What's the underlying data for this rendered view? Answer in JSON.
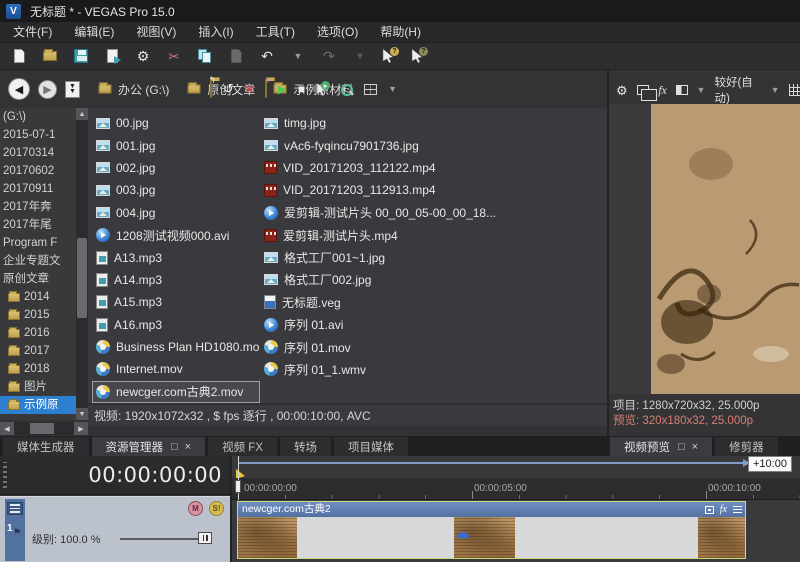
{
  "window": {
    "title": "无标题 * - VEGAS Pro 15.0",
    "app_icon_letter": "V"
  },
  "menu": {
    "items": [
      {
        "label": "文件(F)"
      },
      {
        "label": "编辑(E)"
      },
      {
        "label": "视图(V)"
      },
      {
        "label": "插入(I)"
      },
      {
        "label": "工具(T)"
      },
      {
        "label": "选项(O)"
      },
      {
        "label": "帮助(H)"
      }
    ]
  },
  "toolbar": {
    "icons": [
      "new-project",
      "open-project",
      "save-project",
      "publish",
      "project-properties",
      "cut",
      "copy",
      "paste",
      "undo",
      "undo-dropdown",
      "redo",
      "redo-dropdown",
      "interactive-tutorials",
      "whats-this-help"
    ]
  },
  "explorer": {
    "toolbar_icons": [
      "back",
      "forward",
      "history-dropdown",
      "up-one-level",
      "refresh",
      "delete",
      "new-folder",
      "start-preview",
      "stop-preview",
      "auto-preview",
      "media-search",
      "views",
      "views-dropdown"
    ],
    "address": [
      {
        "label": "办公 (G:\\)",
        "type": "drive"
      },
      {
        "label": "原创文章",
        "type": "folder"
      },
      {
        "label": "示例原材料",
        "type": "folder"
      }
    ],
    "tree": [
      {
        "label": "(G:\\)",
        "type": "root"
      },
      {
        "label": "2015-07-1",
        "type": "plain"
      },
      {
        "label": "20170314",
        "type": "plain"
      },
      {
        "label": "20170602",
        "type": "plain"
      },
      {
        "label": "20170911",
        "type": "plain"
      },
      {
        "label": "2017年奔",
        "type": "plain"
      },
      {
        "label": "2017年尾",
        "type": "plain"
      },
      {
        "label": "Program F",
        "type": "plain"
      },
      {
        "label": "企业专题文",
        "type": "plain"
      },
      {
        "label": "原创文章",
        "type": "plain"
      },
      {
        "label": "2014",
        "type": "folder"
      },
      {
        "label": "2015",
        "type": "folder"
      },
      {
        "label": "2016",
        "type": "folder"
      },
      {
        "label": "2017",
        "type": "folder"
      },
      {
        "label": "2018",
        "type": "folder"
      },
      {
        "label": "图片",
        "type": "folder"
      },
      {
        "label": "示例原",
        "type": "folder",
        "selected": true
      }
    ],
    "files_col1": [
      {
        "name": "00.jpg",
        "type": "jpg"
      },
      {
        "name": "001.jpg",
        "type": "jpg"
      },
      {
        "name": "002.jpg",
        "type": "jpg"
      },
      {
        "name": "003.jpg",
        "type": "jpg"
      },
      {
        "name": "004.jpg",
        "type": "jpg"
      },
      {
        "name": "1208测试视频000.avi",
        "type": "avi"
      },
      {
        "name": "A13.mp3",
        "type": "mp3"
      },
      {
        "name": "A14.mp3",
        "type": "mp3"
      },
      {
        "name": "A15.mp3",
        "type": "mp3"
      },
      {
        "name": "A16.mp3",
        "type": "mp3"
      },
      {
        "name": "Business Plan HD1080.mov",
        "type": "mov"
      },
      {
        "name": "Internet.mov",
        "type": "mov"
      },
      {
        "name": "newcger.com古典2.mov",
        "type": "mov",
        "selected": true
      }
    ],
    "files_col2": [
      {
        "name": "timg.jpg",
        "type": "jpg"
      },
      {
        "name": "vAc6-fyqincu7901736.jpg",
        "type": "jpg"
      },
      {
        "name": "VID_20171203_112122.mp4",
        "type": "mp4"
      },
      {
        "name": "VID_20171203_112913.mp4",
        "type": "mp4"
      },
      {
        "name": "爱剪辑-测试片头 00_00_05-00_00_18...",
        "type": "avi"
      },
      {
        "name": "爱剪辑-测试片头.mp4",
        "type": "mp4"
      },
      {
        "name": "格式工厂001~1.jpg",
        "type": "jpg"
      },
      {
        "name": "格式工厂002.jpg",
        "type": "jpg"
      },
      {
        "name": "无标题.veg",
        "type": "veg"
      },
      {
        "name": "序列 01.avi",
        "type": "avi"
      },
      {
        "name": "序列 01.mov",
        "type": "mov"
      },
      {
        "name": "序列 01_1.wmv",
        "type": "mov"
      }
    ],
    "info": "视频: 1920x1072x32 , $ fps 逐行 , 00:00:10:00, AVC"
  },
  "preview": {
    "toolbar_icons": [
      "project-video-properties",
      "external-monitor",
      "video-output-fx",
      "split-screen-view",
      "preview-quality-dropdown",
      "grid-overlay"
    ],
    "quality": "较好(自动)",
    "project_info": "项目: 1280x720x32, 25.000p",
    "preview_info": "预览: 320x180x32, 25.000p"
  },
  "tabs": {
    "controls": {
      "minimize": "□",
      "close": "×"
    },
    "left": [
      {
        "label": "媒体生成器"
      },
      {
        "label": "资源管理器",
        "selected": true
      },
      {
        "label": "视频 FX"
      },
      {
        "label": "转场"
      },
      {
        "label": "项目媒体"
      }
    ],
    "right": [
      {
        "label": "视频预览",
        "selected": true
      },
      {
        "label": "修剪器"
      }
    ]
  },
  "timeline": {
    "timecode": "00:00:00:00",
    "track": {
      "number": "1",
      "level_label": "级别: 100.0 %",
      "mute": "M",
      "solo": "S!"
    },
    "ruler": [
      "00:00:00:00",
      "00:00:05:00",
      "00:00:10:00"
    ],
    "loop_tooltip": "+10:00",
    "event": {
      "title": "newcger.com古典2",
      "fx_label": "fx"
    }
  },
  "colors": {
    "accent_blue": "#2d7fd0",
    "event_blue": "#5b7db6",
    "event_selection_border": "#ccda7a",
    "preview_info_red": "#d97f72",
    "folder_yellow": "#d9b95c"
  }
}
